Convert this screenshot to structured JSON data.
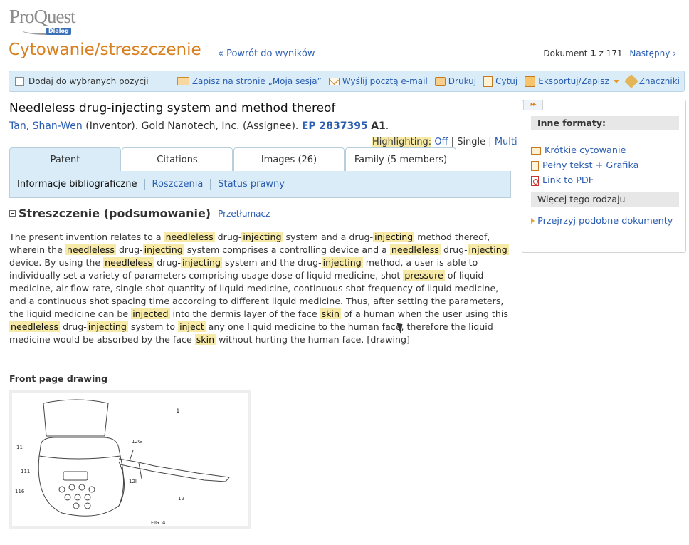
{
  "header": {
    "logo_text": "ProQuest",
    "logo_sub": "Dialog",
    "page_title": "Cytowanie/streszczenie",
    "back_link": "« Powrót do wyników",
    "doc_prefix": "Dokument",
    "doc_current": "1",
    "doc_of": "z 171",
    "next_link": "Następny ›"
  },
  "toolbar": {
    "add_label": "Dodaj do wybranych pozycji",
    "actions": [
      {
        "label": "Zapisz na stronie „Moja sesja”",
        "icon": "save-folder-icon"
      },
      {
        "label": "Wyślij pocztą e-mail",
        "icon": "email-icon"
      },
      {
        "label": "Drukuj",
        "icon": "print-icon"
      },
      {
        "label": "Cytuj",
        "icon": "cite-icon"
      },
      {
        "label": "Eksportuj/Zapisz",
        "icon": "export-icon"
      },
      {
        "label": "Znaczniki",
        "icon": "tag-icon"
      }
    ]
  },
  "document": {
    "title": "Needleless drug-injecting system and method thereof",
    "inventor": "Tan, Shan-Wen",
    "inventor_role": "(Inventor). Gold Nanotech, Inc. (Assignee).",
    "patent_number": "EP 2837395",
    "kind": "A1",
    "trailing": "."
  },
  "highlighting": {
    "label": "Highlighting:",
    "off": "Off",
    "single": "Single",
    "multi": "Multi"
  },
  "tabs": [
    {
      "label": "Patent",
      "active": true
    },
    {
      "label": "Citations"
    },
    {
      "label": "Images (26)"
    },
    {
      "label": "Family (5 members)"
    }
  ],
  "subnav": [
    {
      "label": "Informacje bibliograficzne",
      "active": true
    },
    {
      "label": "Roszczenia"
    },
    {
      "label": "Status prawny"
    }
  ],
  "abstract": {
    "heading": "Streszczenie (podsumowanie)",
    "translate_link": "Przetłumacz",
    "segments": [
      {
        "t": "The present invention relates to a "
      },
      {
        "h": "needleless"
      },
      {
        "t": " drug-"
      },
      {
        "h": "injecting"
      },
      {
        "t": " system and a drug-"
      },
      {
        "h": "injecting"
      },
      {
        "t": " method thereof, wherein the "
      },
      {
        "h": "needleless"
      },
      {
        "t": " drug-"
      },
      {
        "h": "injecting"
      },
      {
        "t": " system comprises a controlling device and a "
      },
      {
        "h": "needleless"
      },
      {
        "t": " drug-"
      },
      {
        "h": "injecting"
      },
      {
        "t": " device. By using the "
      },
      {
        "h": "needleless"
      },
      {
        "t": " drug-"
      },
      {
        "h": "injecting"
      },
      {
        "t": " system and the drug-"
      },
      {
        "h": "injecting"
      },
      {
        "t": " method, a user is able to individually set a variety of parameters comprising usage dose of liquid medicine, shot "
      },
      {
        "h": "pressure"
      },
      {
        "t": " of liquid medicine, air flow rate, single-shot quantity of liquid medicine, continuous shot frequency of liquid medicine, and a continuous shot spacing time according to different liquid medicine. Thus, after setting the parameters, the liquid medicine can be "
      },
      {
        "h": "injected"
      },
      {
        "t": " into the dermis layer of the face "
      },
      {
        "h": "skin"
      },
      {
        "t": " of a human when the user using this "
      },
      {
        "h": "needleless"
      },
      {
        "t": " drug-"
      },
      {
        "h": "injecting"
      },
      {
        "t": " system to "
      },
      {
        "h": "inject"
      },
      {
        "t": " any one liquid medicine to the human face, therefore the liquid medicine would be absorbed by the face "
      },
      {
        "h": "skin"
      },
      {
        "t": " without hurting the human face. [drawing]"
      }
    ]
  },
  "front_page": {
    "label": "Front page drawing",
    "labels": {
      "fig": "FIG. 4",
      "n1": "1",
      "n11": "11",
      "n111": "111",
      "n116": "116",
      "n12": "12",
      "n12G": "12G",
      "n12I": "12I"
    }
  },
  "sidebar": {
    "toggle": "▸▸",
    "formats_title": "Inne formaty:",
    "formats": [
      {
        "label": "Krótkie cytowanie",
        "icon": "short-citation-icon"
      },
      {
        "label": "Pełny tekst + Grafika",
        "icon": "full-text-icon"
      },
      {
        "label": "Link to PDF",
        "icon": "pdf-icon"
      }
    ],
    "more_title": "Więcej tego rodzaju",
    "more_link": "Przejrzyj podobne dokumenty"
  }
}
